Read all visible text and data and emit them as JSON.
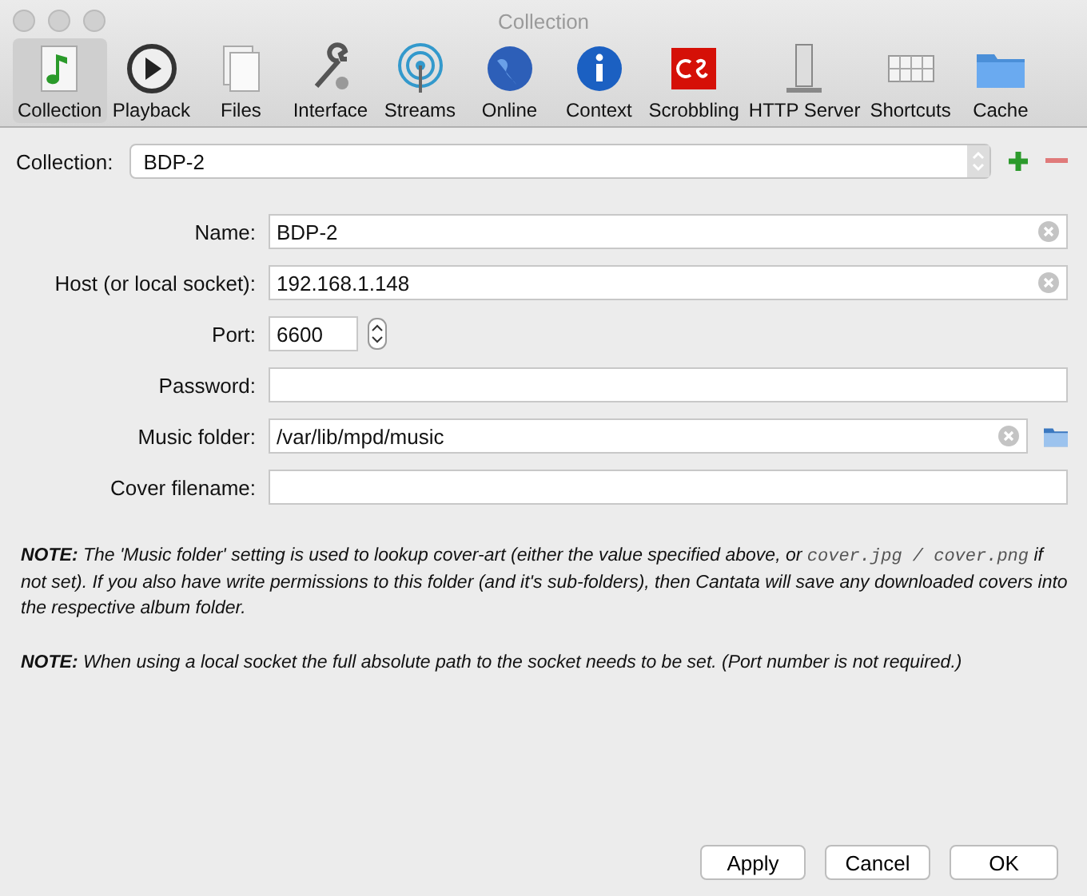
{
  "window": {
    "title": "Collection"
  },
  "toolbar": [
    {
      "label": "Collection",
      "selected": true,
      "kind": "collection"
    },
    {
      "label": "Playback",
      "selected": false,
      "kind": "playback"
    },
    {
      "label": "Files",
      "selected": false,
      "kind": "files"
    },
    {
      "label": "Interface",
      "selected": false,
      "kind": "interface"
    },
    {
      "label": "Streams",
      "selected": false,
      "kind": "streams"
    },
    {
      "label": "Online",
      "selected": false,
      "kind": "online"
    },
    {
      "label": "Context",
      "selected": false,
      "kind": "context"
    },
    {
      "label": "Scrobbling",
      "selected": false,
      "kind": "scrobbling"
    },
    {
      "label": "HTTP Server",
      "selected": false,
      "kind": "http"
    },
    {
      "label": "Shortcuts",
      "selected": false,
      "kind": "shortcuts"
    },
    {
      "label": "Cache",
      "selected": false,
      "kind": "cache"
    }
  ],
  "collection": {
    "label": "Collection:",
    "value": "BDP-2"
  },
  "fields": [
    {
      "label": "Name:",
      "value": "BDP-2",
      "kind": "clearable"
    },
    {
      "label": "Host (or local socket):",
      "value": "192.168.1.148",
      "kind": "clearable"
    },
    {
      "label": "Port:",
      "value": "6600",
      "kind": "spin"
    },
    {
      "label": "Password:",
      "kind": "plain"
    },
    {
      "label": "Music folder:",
      "value": "/var/lib/mpd/music",
      "kind": "folder"
    },
    {
      "label": "Cover filename:",
      "kind": "plain"
    }
  ],
  "notes": [
    [
      {
        "kind": "text",
        "text": "**NOTE:** The 'Music folder' setting is used to lookup cover-art (either the value specified above, or "
      },
      {
        "kind": "code",
        "text": "cover.jpg / cover.png"
      },
      {
        "kind": "text",
        "text": " if not set). If you also have write permissions to this folder (and it's sub-folders), then Cantata will save any downloaded covers into the respective album folder."
      }
    ],
    [
      {
        "kind": "text",
        "text": "**NOTE:** When using a local socket the full absolute path to the socket needs to be set. (Port number is not required.)"
      }
    ]
  ],
  "buttons": [
    "Apply",
    "Cancel",
    "OK"
  ]
}
